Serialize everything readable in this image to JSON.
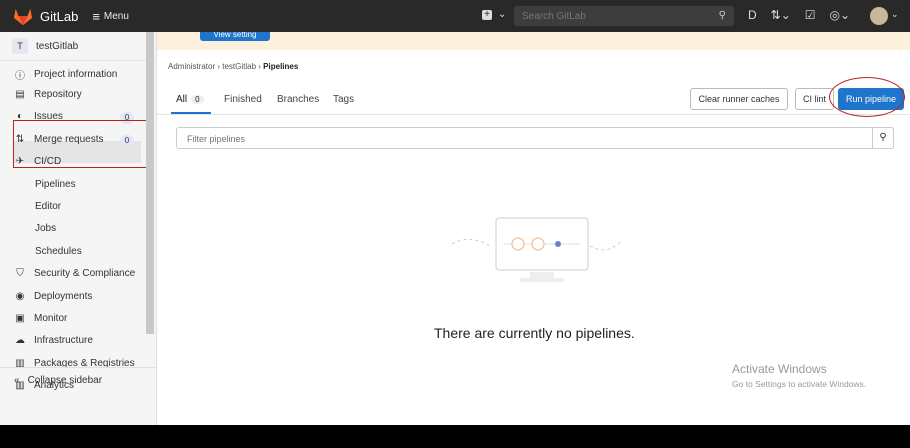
{
  "topbar": {
    "brand": "GitLab",
    "menu_label": "Menu",
    "search_placeholder": "Search GitLab",
    "colors": {
      "bar": "#292929",
      "logo": "#fc6d26"
    }
  },
  "banner": {
    "button_label": "View setting"
  },
  "sidebar": {
    "project_avatar": "T",
    "project_name": "testGitlab",
    "items": [
      {
        "label": "Project information",
        "icon": "info-icon"
      },
      {
        "label": "Repository",
        "icon": "document-icon"
      },
      {
        "label": "Issues",
        "icon": "issues-icon",
        "count": "0"
      },
      {
        "label": "Merge requests",
        "icon": "merge-request-icon",
        "count": "0"
      },
      {
        "label": "CI/CD",
        "icon": "rocket-icon"
      },
      {
        "label": "Security & Compliance",
        "icon": "shield-icon"
      },
      {
        "label": "Deployments",
        "icon": "deployments-icon"
      },
      {
        "label": "Monitor",
        "icon": "monitor-icon"
      },
      {
        "label": "Infrastructure",
        "icon": "cloud-icon"
      },
      {
        "label": "Packages & Registries",
        "icon": "package-icon"
      },
      {
        "label": "Analytics",
        "icon": "chart-icon"
      }
    ],
    "cicd_sub": [
      "Pipelines",
      "Editor",
      "Jobs",
      "Schedules"
    ],
    "collapse_label": "Collapse sidebar"
  },
  "breadcrumb": [
    "Administrator",
    "testGitlab",
    "Pipelines"
  ],
  "tabs": [
    {
      "label": "All",
      "count": "0"
    },
    {
      "label": "Finished"
    },
    {
      "label": "Branches"
    },
    {
      "label": "Tags"
    }
  ],
  "buttons": {
    "clear_caches": "Clear runner caches",
    "ci_lint": "CI lint",
    "run_pipeline": "Run pipeline"
  },
  "filter": {
    "placeholder": "Filter pipelines"
  },
  "empty_state": {
    "message": "There are currently no pipelines."
  },
  "watermark": {
    "line1": "Activate Windows",
    "line2": "Go to Settings to activate Windows."
  }
}
